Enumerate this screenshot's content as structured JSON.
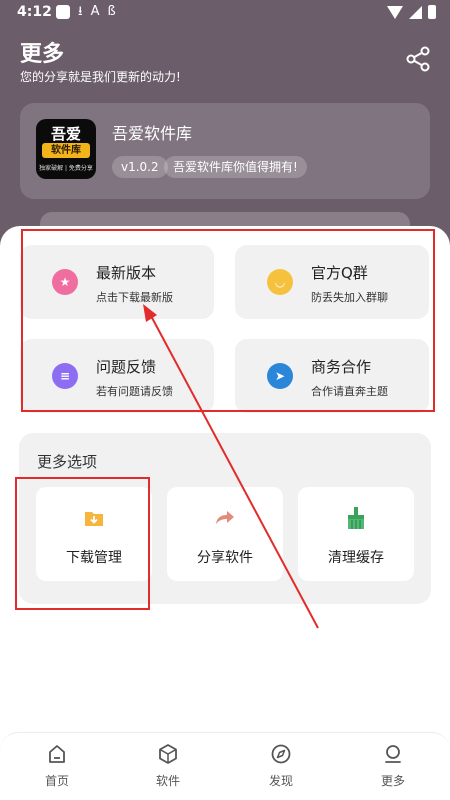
{
  "status": {
    "time": "4:12"
  },
  "header": {
    "title": "更多",
    "subtitle": "您的分享就是我们更新的动力!"
  },
  "app": {
    "name": "吾爱软件库",
    "version": "v1.0.2",
    "slogan": "吾爱软件库你值得拥有!",
    "logo_text_top": "吾爱",
    "logo_text_band": "软件库",
    "logo_text_bottom": "独家破解 | 免费分享"
  },
  "tiles": [
    {
      "title": "最新版本",
      "subtitle": "点击下载最新版",
      "icon": "star-icon",
      "color": "#f06da0"
    },
    {
      "title": "官方Q群",
      "subtitle": "防丢失加入群聊",
      "icon": "chat-bubble-icon",
      "color": "#f6c23e"
    },
    {
      "title": "问题反馈",
      "subtitle": "若有问题请反馈",
      "icon": "feedback-icon",
      "color": "#8d6ef2"
    },
    {
      "title": "商务合作",
      "subtitle": "合作请直奔主题",
      "icon": "telegram-icon",
      "color": "#2a86d9"
    }
  ],
  "more": {
    "title": "更多选项",
    "options": [
      {
        "label": "下载管理",
        "icon": "download-folder-icon"
      },
      {
        "label": "分享软件",
        "icon": "share-arrow-icon"
      },
      {
        "label": "清理缓存",
        "icon": "broom-icon"
      }
    ]
  },
  "nav": [
    {
      "label": "首页",
      "icon": "home-icon"
    },
    {
      "label": "软件",
      "icon": "box-icon"
    },
    {
      "label": "发现",
      "icon": "compass-icon"
    },
    {
      "label": "更多",
      "icon": "user-icon"
    }
  ],
  "colors": {
    "header_bg": "#6b5e6a",
    "highlight": "#e32b2b",
    "tile_bg": "#f1f1f1"
  }
}
